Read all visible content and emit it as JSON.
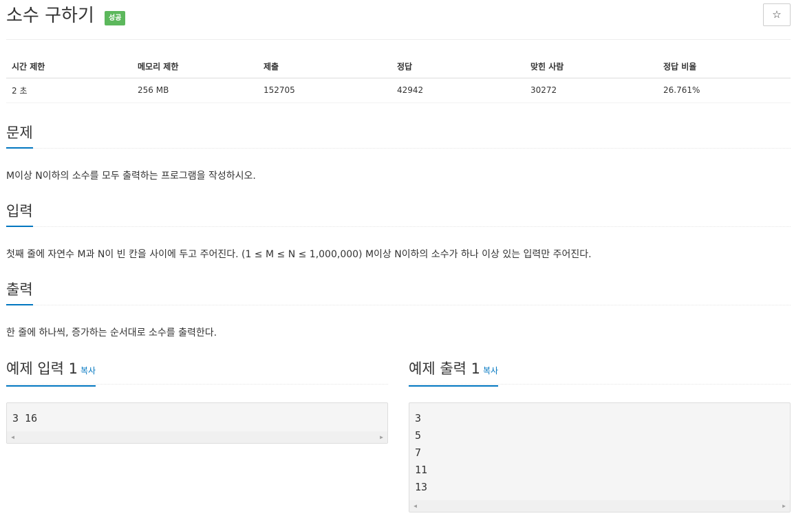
{
  "problem": {
    "title": "소수 구하기",
    "status_badge": "성공",
    "star_icon": "☆"
  },
  "info_table": {
    "headers": [
      "시간 제한",
      "메모리 제한",
      "제출",
      "정답",
      "맞힌 사람",
      "정답 비율"
    ],
    "values": [
      "2 초",
      "256 MB",
      "152705",
      "42942",
      "30272",
      "26.761%"
    ]
  },
  "sections": {
    "description": {
      "heading": "문제",
      "text": "M이상 N이하의 소수를 모두 출력하는 프로그램을 작성하시오."
    },
    "input": {
      "heading": "입력",
      "text": "첫째 줄에 자연수 M과 N이 빈 칸을 사이에 두고 주어진다. (1 ≤ M ≤ N ≤ 1,000,000) M이상 N이하의 소수가 하나 이상 있는 입력만 주어진다."
    },
    "output": {
      "heading": "출력",
      "text": "한 줄에 하나씩, 증가하는 순서대로 소수를 출력한다."
    }
  },
  "samples": {
    "input": {
      "heading": "예제 입력 1",
      "copy_label": "복사",
      "content": "3 16"
    },
    "output": {
      "heading": "예제 출력 1",
      "copy_label": "복사",
      "content": "3\n5\n7\n11\n13"
    }
  },
  "scroll_icons": {
    "left": "◀",
    "right": "▶"
  }
}
